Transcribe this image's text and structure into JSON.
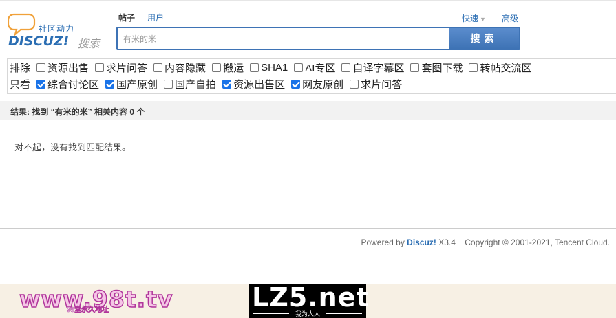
{
  "logo": {
    "community": "社区动力",
    "brand": "DISCUZ!",
    "brand_sub": "搜索",
    "icon": "chat-bubble-icon"
  },
  "search": {
    "types": [
      "帖子",
      "用户"
    ],
    "active_type": "帖子",
    "quick_label": "快速",
    "advanced_label": "高级",
    "value": "有米的米",
    "button_label": "搜索",
    "accent": "#3e73b5"
  },
  "filters": {
    "exclude_label": "排除",
    "exclude_options": [
      {
        "label": "资源出售",
        "checked": false
      },
      {
        "label": "求片问答",
        "checked": false
      },
      {
        "label": "内容隐藏",
        "checked": false
      },
      {
        "label": "搬运",
        "checked": false
      },
      {
        "label": "SHA1",
        "checked": false
      },
      {
        "label": "AI专区",
        "checked": false
      },
      {
        "label": "自译字幕区",
        "checked": false
      },
      {
        "label": "套图下载",
        "checked": false
      },
      {
        "label": "转帖交流区",
        "checked": false
      }
    ],
    "only_label": "只看",
    "only_options": [
      {
        "label": "综合讨论区",
        "checked": true
      },
      {
        "label": "国产原创",
        "checked": true
      },
      {
        "label": "国产自拍",
        "checked": false
      },
      {
        "label": "资源出售区",
        "checked": true
      },
      {
        "label": "网友原创",
        "checked": true
      },
      {
        "label": "求片问答",
        "checked": false
      }
    ]
  },
  "results": {
    "summary": "结果: 找到 “有米的米” 相关内容 0 个",
    "empty_message": "对不起，没有找到匹配结果。"
  },
  "footer": {
    "powered_prefix": "Powered by",
    "brand": "Discuz!",
    "version": "X3.4",
    "copyright": "Copyright © 2001-2021, Tencent Cloud."
  },
  "banner": {
    "left_text": "www.98t.tv",
    "left_sub": "98堂永久地址",
    "right_text": "LZ5.net",
    "right_sub": "我为人人"
  }
}
